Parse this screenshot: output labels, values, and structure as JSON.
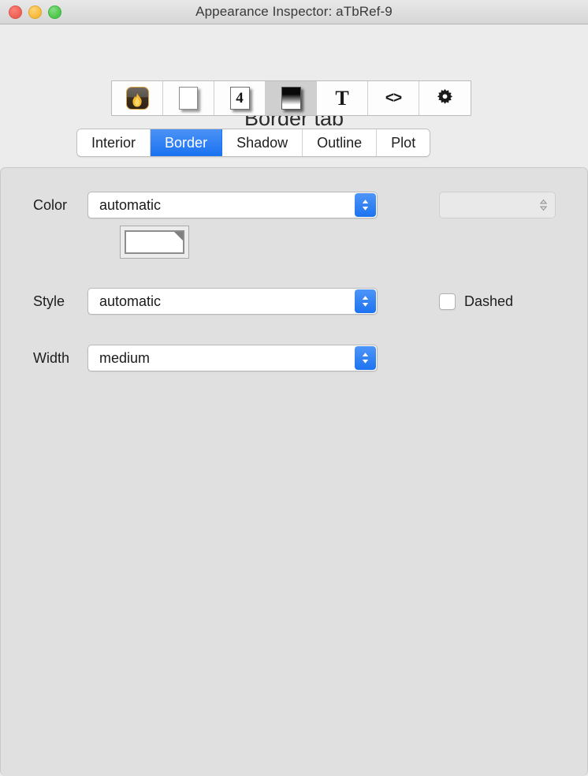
{
  "window": {
    "title": "Appearance Inspector: aTbRef-9",
    "controls": {
      "close": "close-button",
      "minimize": "minimize-button",
      "zoom": "zoom-button"
    }
  },
  "toolbar": {
    "items": [
      {
        "icon": "flame-icon",
        "name": "tab-appearance-flame",
        "selected": false
      },
      {
        "icon": "page-icon",
        "name": "tab-page",
        "selected": false
      },
      {
        "icon": "page-number-icon",
        "name": "tab-page-number",
        "selected": false,
        "glyph": "4"
      },
      {
        "icon": "gradient-icon",
        "name": "tab-appearance-gradient",
        "selected": true
      },
      {
        "icon": "text-icon",
        "name": "tab-text",
        "selected": false,
        "glyph": "T"
      },
      {
        "icon": "code-icon",
        "name": "tab-code",
        "selected": false,
        "glyph": "<>"
      },
      {
        "icon": "gear-icon",
        "name": "tab-settings",
        "selected": false
      }
    ]
  },
  "heading": "Border tab",
  "tabs": [
    {
      "label": "Interior",
      "active": false
    },
    {
      "label": "Border",
      "active": true
    },
    {
      "label": "Shadow",
      "active": false
    },
    {
      "label": "Outline",
      "active": false
    },
    {
      "label": "Plot",
      "active": false
    }
  ],
  "form": {
    "color": {
      "label": "Color",
      "value": "automatic",
      "secondary_value": "",
      "swatch_color": "#ffffff"
    },
    "style": {
      "label": "Style",
      "value": "automatic",
      "dashed_label": "Dashed",
      "dashed_checked": false
    },
    "width": {
      "label": "Width",
      "value": "medium"
    }
  },
  "colors": {
    "accent": "#1d73f0",
    "window_bg": "#ececec",
    "panel_bg": "#e0e0e0",
    "close": "#ef6459",
    "minimize": "#f8bd40",
    "zoom": "#54c94f"
  }
}
